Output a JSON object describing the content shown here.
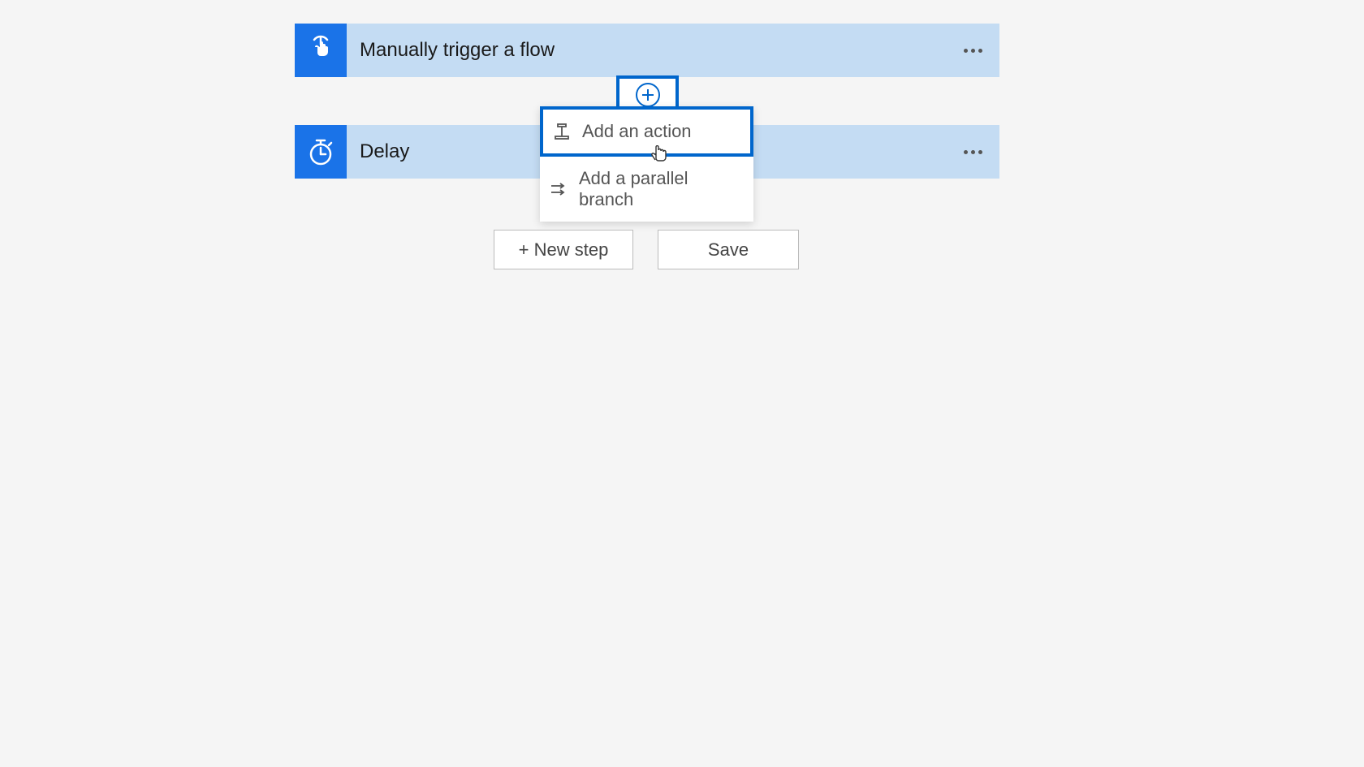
{
  "trigger": {
    "label": "Manually trigger a flow"
  },
  "delay": {
    "label": "Delay"
  },
  "insertMenu": {
    "addAction": "Add an action",
    "addParallel": "Add a parallel branch"
  },
  "buttons": {
    "newStep": "+ New step",
    "save": "Save"
  }
}
